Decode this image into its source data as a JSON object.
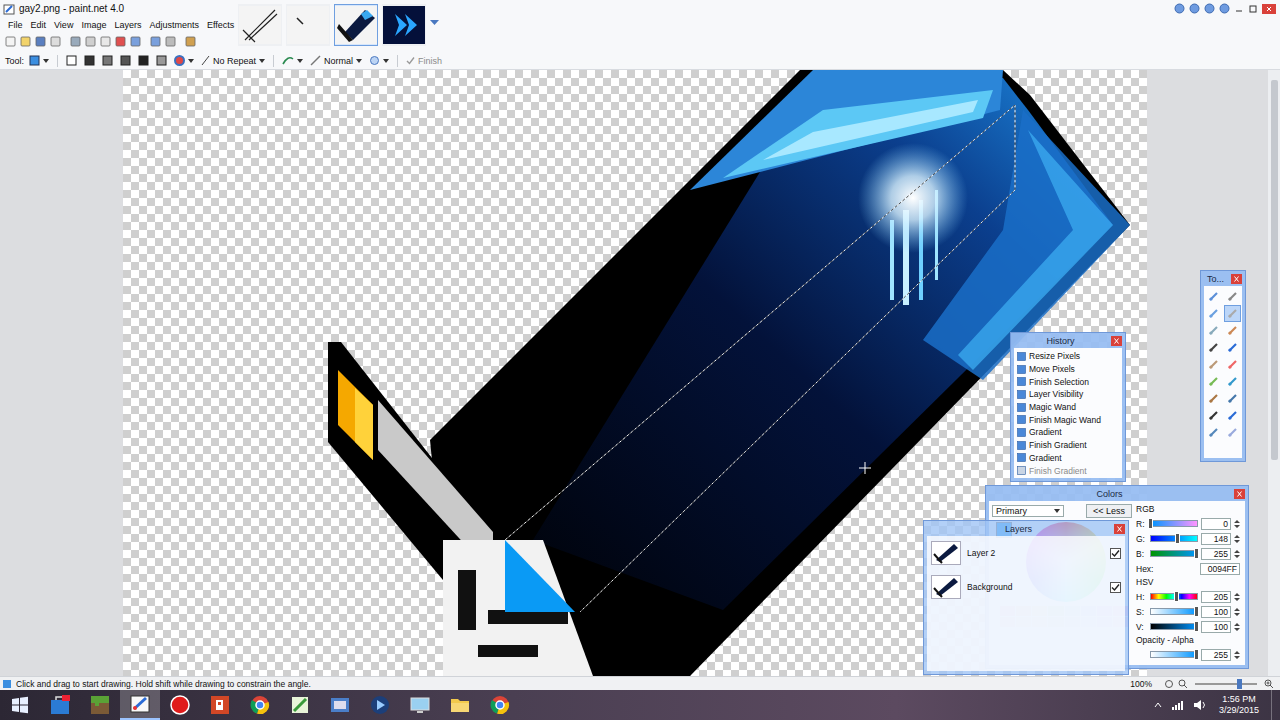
{
  "window": {
    "title": "gay2.png - paint.net 4.0"
  },
  "menu": [
    "File",
    "Edit",
    "View",
    "Image",
    "Layers",
    "Adjustments",
    "Effects"
  ],
  "images": [
    {
      "kind": "sketch",
      "selected": false
    },
    {
      "kind": "line",
      "selected": false
    },
    {
      "kind": "sword",
      "selected": true
    },
    {
      "kind": "banner",
      "selected": false
    }
  ],
  "tool_bar": {
    "tool_label": "Tool:",
    "fill": "No Repeat",
    "blend": "Normal",
    "finish": "Finish",
    "finish_disabled": true
  },
  "tools_window": {
    "title": "To..."
  },
  "history": {
    "title": "History",
    "items": [
      {
        "label": "Resize Pixels",
        "disabled": false
      },
      {
        "label": "Move Pixels",
        "disabled": false
      },
      {
        "label": "Finish Selection",
        "disabled": false
      },
      {
        "label": "Layer Visibility",
        "disabled": false
      },
      {
        "label": "Magic Wand",
        "disabled": false
      },
      {
        "label": "Finish Magic Wand",
        "disabled": false
      },
      {
        "label": "Gradient",
        "disabled": false
      },
      {
        "label": "Finish Gradient",
        "disabled": false
      },
      {
        "label": "Gradient",
        "disabled": false
      },
      {
        "label": "Finish Gradient",
        "disabled": true
      }
    ]
  },
  "colors": {
    "title": "Colors",
    "target": "Primary",
    "less": "<< Less",
    "rgb_label": "RGB",
    "rgb": [
      {
        "name": "R:",
        "value": "0",
        "level": 0
      },
      {
        "name": "G:",
        "value": "148",
        "level": 0.58
      },
      {
        "name": "B:",
        "value": "255",
        "level": 1
      }
    ],
    "hex_label": "Hex:",
    "hex": "0094FF",
    "hsv_label": "HSV",
    "hsv": [
      {
        "name": "H:",
        "value": "205",
        "level": 0.57
      },
      {
        "name": "S:",
        "value": "100",
        "level": 1
      },
      {
        "name": "V:",
        "value": "100",
        "level": 1
      }
    ],
    "alpha_label": "Opacity - Alpha",
    "alpha": {
      "value": "255",
      "level": 1
    }
  },
  "layers": {
    "title": "Layers",
    "items": [
      {
        "name": "Layer 2",
        "visible": true,
        "selected": false
      },
      {
        "name": "Background",
        "visible": true,
        "selected": false
      }
    ]
  },
  "status_bar": {
    "hint": "Click and drag to start drawing. Hold shift while drawing to constrain the angle.",
    "zoom": "100%",
    "zoom_level": 0.72
  },
  "taskbar": {
    "apps": [
      {
        "kind": "store",
        "selected": false
      },
      {
        "kind": "minecraft",
        "selected": false
      },
      {
        "kind": "paintnet",
        "selected": true
      },
      {
        "kind": "record",
        "selected": false
      },
      {
        "kind": "powerpoint",
        "selected": false
      },
      {
        "kind": "chrome",
        "selected": false
      },
      {
        "kind": "notepad",
        "selected": false
      },
      {
        "kind": "java",
        "selected": false
      },
      {
        "kind": "media",
        "selected": false
      },
      {
        "kind": "monitor",
        "selected": false
      },
      {
        "kind": "folder",
        "selected": false
      },
      {
        "kind": "chrome",
        "selected": false
      }
    ],
    "time": "1:56 PM",
    "date": "3/29/2015"
  }
}
